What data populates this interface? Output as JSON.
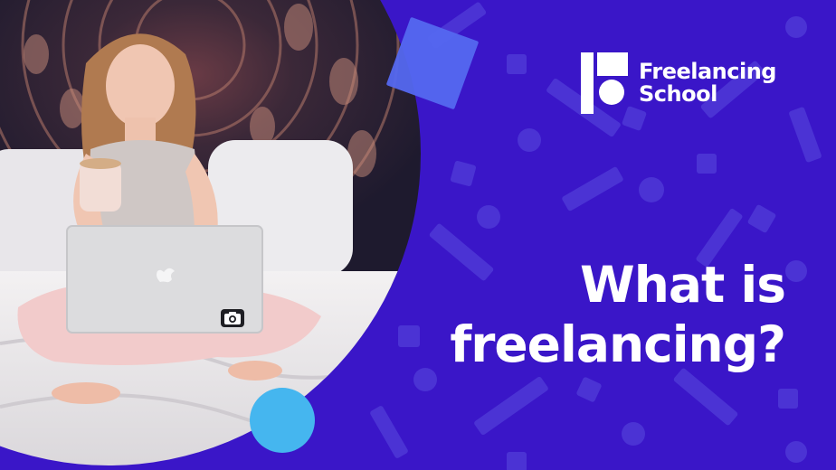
{
  "colors": {
    "background": "#3a16c8",
    "pattern": "#4b33d4",
    "accent_square": "#5468f0",
    "accent_dot": "#45b6ef",
    "text": "#ffffff"
  },
  "logo": {
    "line1": "Freelancing",
    "line2": "School",
    "icon": "freelancing-school-logo-icon"
  },
  "headline": {
    "line1": "What is",
    "line2": "freelancing?"
  },
  "photo": {
    "icon": "woman-with-laptop-photo"
  }
}
